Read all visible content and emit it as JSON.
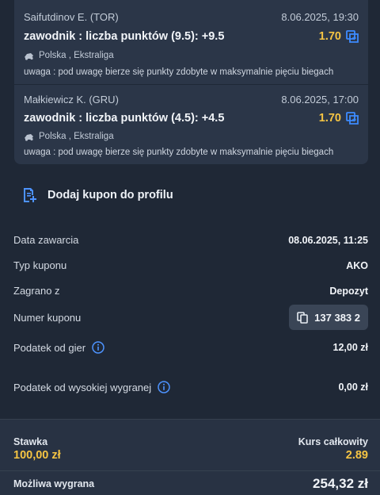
{
  "bets": [
    {
      "player": "Saifutdinov E. (TOR)",
      "datetime": "8.06.2025, 19:30",
      "market": "zawodnik : liczba punktów (9.5): +9.5",
      "odd": "1.70",
      "league": "Polska , Ekstraliga",
      "note": "uwaga : pod uwagę bierze się punkty zdobyte w maksymalnie pięciu biegach"
    },
    {
      "player": "Małkiewicz K. (GRU)",
      "datetime": "8.06.2025, 17:00",
      "market": "zawodnik : liczba punktów (4.5): +4.5",
      "odd": "1.70",
      "league": "Polska , Ekstraliga",
      "note": "uwaga : pod uwagę bierze się punkty zdobyte w maksymalnie pięciu biegach"
    }
  ],
  "add_coupon": {
    "label": "Dodaj kupon do profilu"
  },
  "details": {
    "date_label": "Data zawarcia",
    "date_value": "08.06.2025, 11:25",
    "type_label": "Typ kuponu",
    "type_value": "AKO",
    "played_label": "Zagrano z",
    "played_value": "Depozyt",
    "coupon_label": "Numer kuponu",
    "coupon_value": "137 383 2",
    "tax_label": "Podatek od gier",
    "tax_value": "12,00 zł",
    "hightax_label": "Podatek od wysokiej wygranej",
    "hightax_value": "0,00 zł"
  },
  "summary": {
    "stake_label": "Stawka",
    "stake_value": "100,00 zł",
    "total_odds_label": "Kurs całkowity",
    "total_odds_value": "2.89",
    "possible_win_label": "Możliwa wygrana",
    "possible_win_value": "254,32 zł"
  },
  "colors": {
    "accent": "#f5c443",
    "link_blue": "#3d8bff",
    "background": "#1f2836",
    "card": "#2b3648"
  },
  "icons": [
    "copy-bet-icon",
    "speedway-icon",
    "add-coupon-icon",
    "copy-icon",
    "info-icon"
  ]
}
